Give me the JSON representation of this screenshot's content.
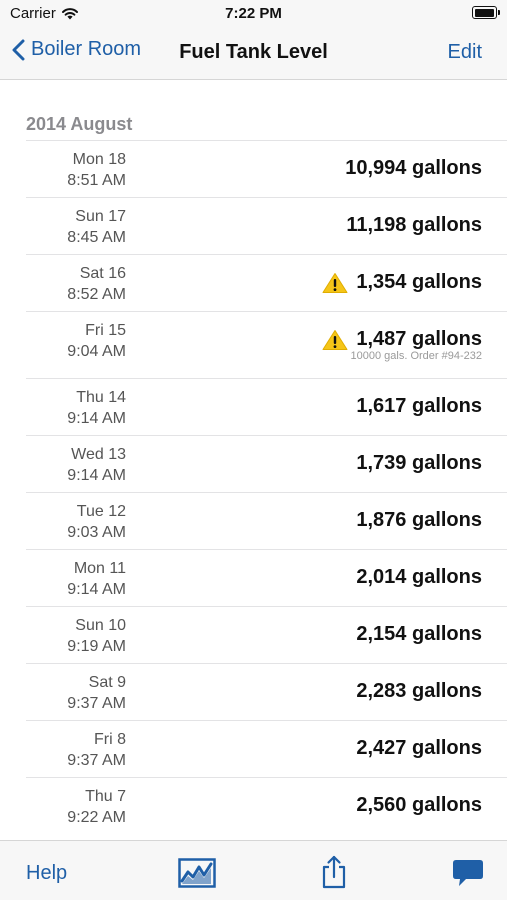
{
  "status": {
    "carrier": "Carrier",
    "time": "7:22 PM"
  },
  "nav": {
    "back_label": "Boiler Room",
    "title": "Fuel Tank Level",
    "edit_label": "Edit"
  },
  "section": {
    "header": "2014 August"
  },
  "readings": [
    {
      "day": "Mon 18",
      "time": "8:51 AM",
      "value": "10,994 gallons",
      "warning": false,
      "note": ""
    },
    {
      "day": "Sun 17",
      "time": "8:45 AM",
      "value": "11,198 gallons",
      "warning": false,
      "note": ""
    },
    {
      "day": "Sat 16",
      "time": "8:52 AM",
      "value": "1,354 gallons",
      "warning": true,
      "note": ""
    },
    {
      "day": "Fri 15",
      "time": "9:04 AM",
      "value": "1,487 gallons",
      "warning": true,
      "note": "10000 gals. Order #94-232"
    },
    {
      "day": "Thu 14",
      "time": "9:14 AM",
      "value": "1,617 gallons",
      "warning": false,
      "note": ""
    },
    {
      "day": "Wed 13",
      "time": "9:14 AM",
      "value": "1,739 gallons",
      "warning": false,
      "note": ""
    },
    {
      "day": "Tue 12",
      "time": "9:03 AM",
      "value": "1,876 gallons",
      "warning": false,
      "note": ""
    },
    {
      "day": "Mon 11",
      "time": "9:14 AM",
      "value": "2,014 gallons",
      "warning": false,
      "note": ""
    },
    {
      "day": "Sun 10",
      "time": "9:19 AM",
      "value": "2,154 gallons",
      "warning": false,
      "note": ""
    },
    {
      "day": "Sat 9",
      "time": "9:37 AM",
      "value": "2,283 gallons",
      "warning": false,
      "note": ""
    },
    {
      "day": "Fri 8",
      "time": "9:37 AM",
      "value": "2,427 gallons",
      "warning": false,
      "note": ""
    },
    {
      "day": "Thu 7",
      "time": "9:22 AM",
      "value": "2,560 gallons",
      "warning": false,
      "note": ""
    }
  ],
  "toolbar": {
    "help_label": "Help",
    "chart_icon": "line-chart-icon",
    "share_icon": "share-icon",
    "chat_icon": "chat-bubble-icon"
  },
  "colors": {
    "accent": "#1f5fa7",
    "warning": "#f5c518",
    "separator": "#e3e3e5",
    "bar_background": "#f7f7f7"
  }
}
